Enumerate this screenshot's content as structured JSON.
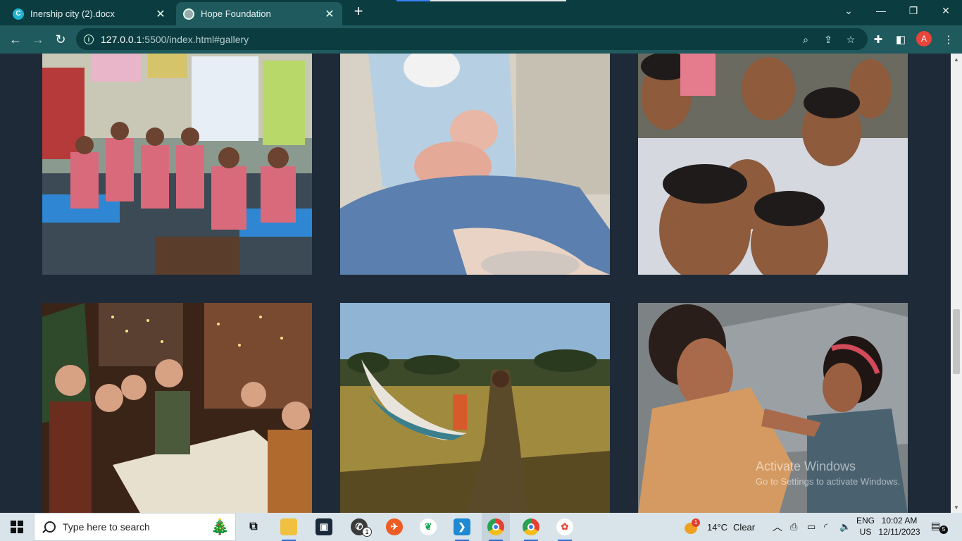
{
  "browser": {
    "tabs": [
      {
        "title": "Inership city (2).docx",
        "icon": "canva-icon",
        "active": false
      },
      {
        "title": "Hope Foundation",
        "icon": "broadcast-icon",
        "active": true
      }
    ],
    "address": {
      "host": "127.0.0.1",
      "rest": ":5500/index.html#gallery"
    },
    "profile_initial": "A"
  },
  "gallery": {
    "images": [
      {
        "label": "classroom-children-photo"
      },
      {
        "label": "newborn-delivery-photo"
      },
      {
        "label": "smiling-children-group-photo"
      },
      {
        "label": "family-dinner-celebration-photo"
      },
      {
        "label": "beach-boat-woman-photo"
      },
      {
        "label": "mother-daughter-photo"
      }
    ]
  },
  "watermark": {
    "line1": "Activate Windows",
    "line2": "Go to Settings to activate Windows."
  },
  "taskbar": {
    "search_placeholder": "Type here to search",
    "weather": {
      "temp": "14°C",
      "condition": "Clear",
      "alert": "1"
    },
    "lang": {
      "l1": "ENG",
      "l2": "US"
    },
    "time": "10:02 AM",
    "date": "12/11/2023",
    "notification_count": "5",
    "whatsapp_badge": "1"
  },
  "colors": {
    "page_bg": "#1e2a38",
    "tab_bar": "#0b3c40",
    "toolbar": "#1f5a5e",
    "taskbar": "#d9e3ea"
  }
}
